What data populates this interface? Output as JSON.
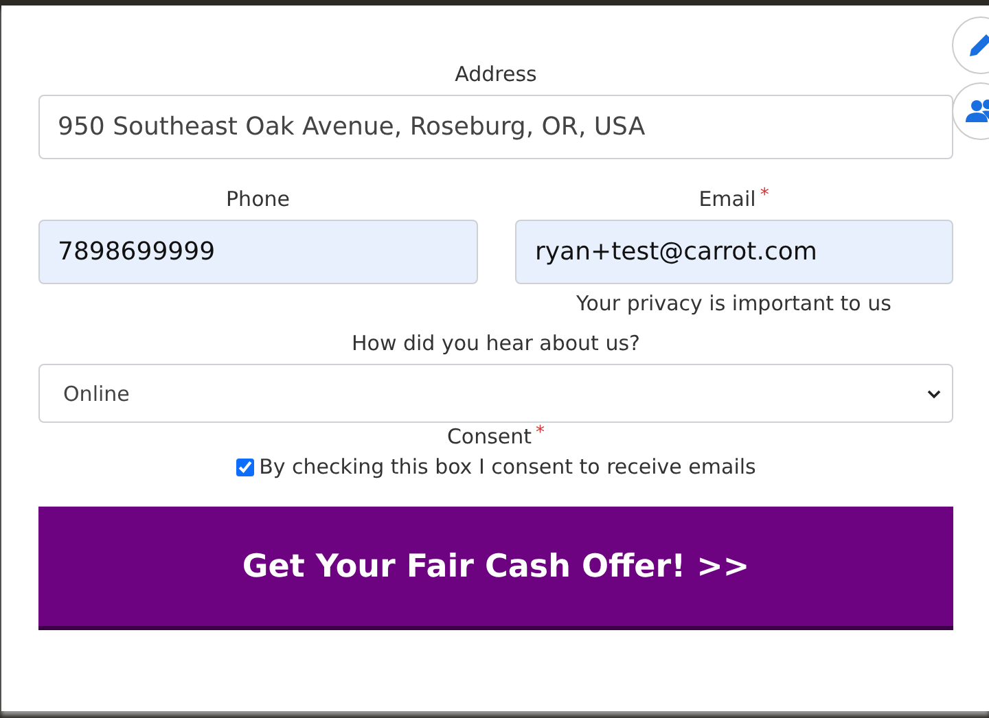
{
  "address": {
    "label": "Address",
    "value": "950 Southeast Oak Avenue, Roseburg, OR, USA"
  },
  "phone": {
    "label": "Phone",
    "value": "7898699999"
  },
  "email": {
    "label": "Email",
    "required_mark": "*",
    "value": "ryan+test@carrot.com",
    "note": "Your privacy is important to us"
  },
  "source": {
    "label": "How did you hear about us?",
    "value": "Online"
  },
  "consent": {
    "label": "Consent",
    "required_mark": "*",
    "checkbox_label": "By checking this box I consent to receive emails",
    "checked": true
  },
  "submit_button": "Get Your Fair Cash Offer! >>"
}
